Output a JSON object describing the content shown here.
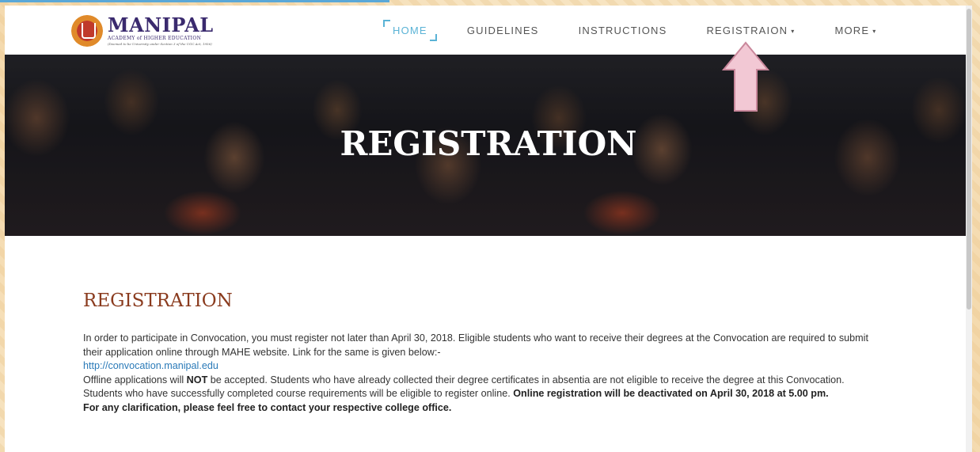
{
  "logo": {
    "name": "MANIPAL",
    "subtitle": "ACADEMY of HIGHER EDUCATION",
    "tagline": "(Deemed to be University under Section 3 of the UGC Act, 1956)"
  },
  "nav": {
    "items": [
      {
        "label": "HOME",
        "active": true
      },
      {
        "label": "GUIDELINES"
      },
      {
        "label": "INSTRUCTIONS"
      },
      {
        "label": "REGISTRAION",
        "dropdown": true
      },
      {
        "label": "MORE",
        "dropdown": true
      }
    ],
    "caret": "▾"
  },
  "hero": {
    "title": "REGISTRATION"
  },
  "main": {
    "heading": "REGISTRATION",
    "p1": "In order to participate in Convocation, you must register not later than April 30, 2018.  Eligible students who want to receive their degrees at the Convocation are required to submit their application  online through  MAHE website. Link for the same is given below:-",
    "link": "http://convocation.manipal.edu",
    "p2_a": " Offline applications will ",
    "p2_not": "NOT",
    "p2_b": " be accepted. Students who have already collected their degree certificates in absentia are not eligible to receive the degree at this Convocation.  Students who have successfully completed course requirements will be eligible to register online. ",
    "p2_bold": "Online registration will be deactivated on April 30, 2018 at 5.00 pm.",
    "p3": "For any clarification, please feel free to contact your respective college office."
  },
  "colors": {
    "accent": "#5ab3d6",
    "heading": "#8a3b1e",
    "link": "#2a7ab8",
    "arrow": "#f2c8d4"
  }
}
